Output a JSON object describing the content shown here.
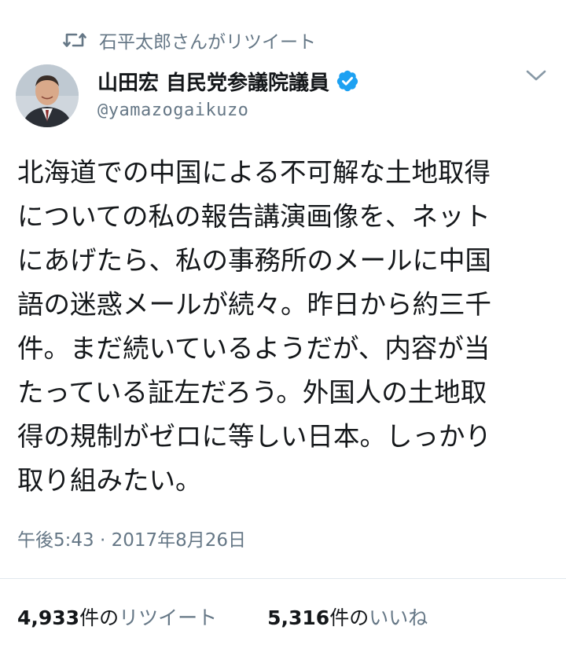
{
  "retweet_context": {
    "text": "石平太郎さんがリツイート",
    "icon": "retweet-icon"
  },
  "author": {
    "display_name": "山田宏  自民党参議院議員",
    "handle": "@yamazogaikuzo",
    "verified": true,
    "verified_icon": "verified-badge-icon"
  },
  "menu_icon": "chevron-down-icon",
  "tweet": {
    "lines": [
      "北海道での中国による不可解な土地取得",
      "についての私の報告講演画像を、ネット",
      "にあげたら、私の事務所のメールに中国",
      "語の迷惑メールが続々。昨日から約三千",
      "件。まだ続いているようだが、内容が当",
      "たっている証左だろう。外国人の土地取",
      "得の規制がゼロに等しい日本。しっかり",
      "取り組みたい。"
    ],
    "timestamp": "午後5:43 · 2017年8月26日"
  },
  "stats": {
    "retweets": {
      "count": "4,933",
      "unit": "件の",
      "label": "リツイート"
    },
    "likes": {
      "count": "5,316",
      "unit": "件の",
      "label": "いいね"
    }
  },
  "colors": {
    "text": "#14171a",
    "secondary": "#657786",
    "verified": "#1da1f2",
    "divider": "#e1e8ed"
  }
}
